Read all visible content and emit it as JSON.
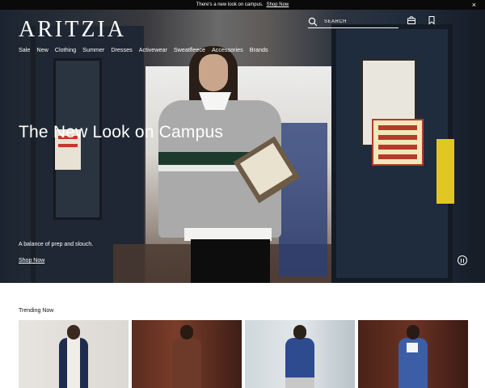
{
  "promo": {
    "message": "There's a new look on campus.",
    "link_label": "Shop Now",
    "close_icon": "close-icon"
  },
  "header": {
    "logo": "ARITZIA",
    "search_placeholder": "SEARCH",
    "icons": [
      "search-icon",
      "shopping-bag-icon",
      "wishlist-bookmark-icon"
    ]
  },
  "nav": {
    "items": [
      "Sale",
      "New",
      "Clothing",
      "Summer",
      "Dresses",
      "Activewear",
      "Sweatfleece",
      "Accessories",
      "Brands"
    ]
  },
  "hero": {
    "title": "The New Look on Campus",
    "subtitle": "A balance of prep and slouch.",
    "cta": "Shop Now",
    "pause_icon": "pause-icon"
  },
  "trending": {
    "title": "Trending Now",
    "products": [
      {
        "name": "navy-cream-zip-sweater"
      },
      {
        "name": "brown-hoodie"
      },
      {
        "name": "blue-long-sleeve-top"
      },
      {
        "name": "blue-varsity-sweater"
      }
    ]
  },
  "colors": {
    "promo_bg": "#0a0a0a",
    "text_light": "#ffffff",
    "text_dark": "#111111"
  }
}
